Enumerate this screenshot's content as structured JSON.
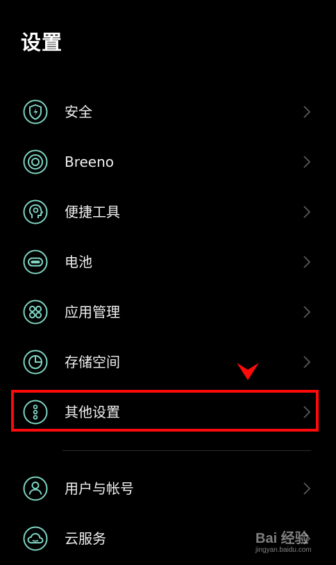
{
  "header": {
    "title": "设置"
  },
  "colors": {
    "accent": "#7fd6c3",
    "highlight": "#ff0a0a",
    "background": "#000000"
  },
  "items": [
    {
      "label": "安全",
      "icon": "shield-icon"
    },
    {
      "label": "Breeno",
      "icon": "breeno-icon"
    },
    {
      "label": "便捷工具",
      "icon": "head-gear-icon"
    },
    {
      "label": "电池",
      "icon": "battery-icon"
    },
    {
      "label": "应用管理",
      "icon": "apps-icon"
    },
    {
      "label": "存储空间",
      "icon": "storage-pie-icon"
    },
    {
      "label": "其他设置",
      "icon": "more-vertical-icon"
    },
    {
      "label": "用户与帐号",
      "icon": "user-icon"
    },
    {
      "label": "云服务",
      "icon": "cloud-icon"
    }
  ],
  "watermark": {
    "brand": "Bai 经验",
    "site": "jingyan.baidu.com"
  }
}
